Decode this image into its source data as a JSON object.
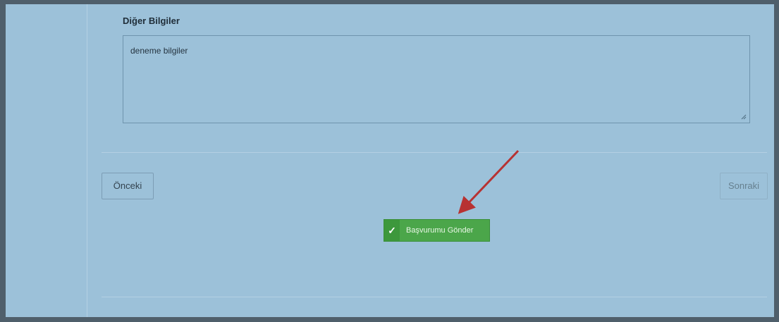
{
  "form": {
    "field_label": "Diğer Bilgiler",
    "textarea_value": "deneme bilgiler"
  },
  "nav": {
    "prev_label": "Önceki",
    "next_label": "Sonraki"
  },
  "submit": {
    "label": "Başvurumu Gönder",
    "icon": "check-icon"
  },
  "colors": {
    "page_bg": "#9cc1d9",
    "submit_bg": "#4ba64a",
    "annotation_arrow": "#b73232"
  }
}
